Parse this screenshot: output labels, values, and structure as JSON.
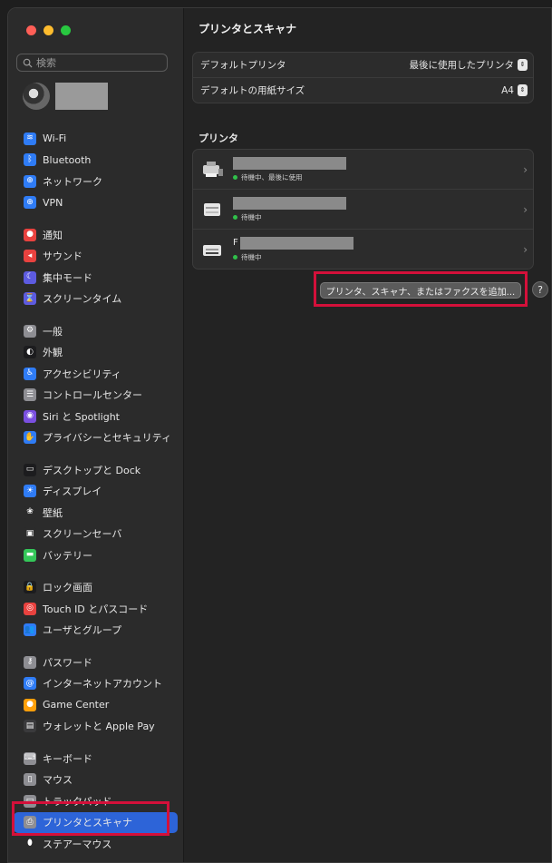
{
  "window": {
    "title": "プリンタとスキャナ"
  },
  "traffic_colors": {
    "close": "#ff5f57",
    "minimize": "#febc2e",
    "zoom": "#28c840"
  },
  "search": {
    "placeholder": "検索"
  },
  "sidebar": {
    "groups": [
      [
        {
          "label": "Wi-Fi",
          "icon": "wifi-icon",
          "color": "#2f7cf6",
          "glyph": "≋"
        },
        {
          "label": "Bluetooth",
          "icon": "bluetooth-icon",
          "color": "#2f7cf6",
          "glyph": "ᛒ"
        },
        {
          "label": "ネットワーク",
          "icon": "globe-icon",
          "color": "#2f7cf6",
          "glyph": "⊕"
        },
        {
          "label": "VPN",
          "icon": "vpn-icon",
          "color": "#2f7cf6",
          "glyph": "⊕"
        }
      ],
      [
        {
          "label": "通知",
          "icon": "bell-icon",
          "color": "#e9423f",
          "glyph": "●"
        },
        {
          "label": "サウンド",
          "icon": "speaker-icon",
          "color": "#e9423f",
          "glyph": "◂"
        },
        {
          "label": "集中モード",
          "icon": "moon-icon",
          "color": "#5d5be0",
          "glyph": "☾"
        },
        {
          "label": "スクリーンタイム",
          "icon": "hourglass-icon",
          "color": "#5d5be0",
          "glyph": "⌛"
        }
      ],
      [
        {
          "label": "一般",
          "icon": "gear-icon",
          "color": "#8e8e93",
          "glyph": "⚙"
        },
        {
          "label": "外観",
          "icon": "appearance-icon",
          "color": "#1c1c1e",
          "glyph": "◐"
        },
        {
          "label": "アクセシビリティ",
          "icon": "accessibility-icon",
          "color": "#2f7cf6",
          "glyph": "♿"
        },
        {
          "label": "コントロールセンター",
          "icon": "control-center-icon",
          "color": "#8e8e93",
          "glyph": "☰"
        },
        {
          "label": "Siri と Spotlight",
          "icon": "siri-icon",
          "color": "#7a4fe0",
          "glyph": "◉"
        },
        {
          "label": "プライバシーとセキュリティ",
          "icon": "hand-icon",
          "color": "#2f7cf6",
          "glyph": "✋"
        }
      ],
      [
        {
          "label": "デスクトップと Dock",
          "icon": "dock-icon",
          "color": "#1c1c1e",
          "glyph": "▭"
        },
        {
          "label": "ディスプレイ",
          "icon": "display-icon",
          "color": "#2f7cf6",
          "glyph": "☀"
        },
        {
          "label": "壁紙",
          "icon": "wallpaper-icon",
          "color": "#2b2b2b",
          "glyph": "❀"
        },
        {
          "label": "スクリーンセーバ",
          "icon": "screensaver-icon",
          "color": "#2b2b2b",
          "glyph": "▣"
        },
        {
          "label": "バッテリー",
          "icon": "battery-icon",
          "color": "#34c759",
          "glyph": "▬"
        }
      ],
      [
        {
          "label": "ロック画面",
          "icon": "lock-icon",
          "color": "#1c1c1e",
          "glyph": "🔒"
        },
        {
          "label": "Touch ID とパスコード",
          "icon": "fingerprint-icon",
          "color": "#e9423f",
          "glyph": "◎"
        },
        {
          "label": "ユーザとグループ",
          "icon": "users-icon",
          "color": "#2f7cf6",
          "glyph": "👥"
        }
      ],
      [
        {
          "label": "パスワード",
          "icon": "key-icon",
          "color": "#8e8e93",
          "glyph": "⚷"
        },
        {
          "label": "インターネットアカウント",
          "icon": "at-icon",
          "color": "#2f7cf6",
          "glyph": "@"
        },
        {
          "label": "Game Center",
          "icon": "game-center-icon",
          "color": "#ff9f0a",
          "glyph": "●"
        },
        {
          "label": "ウォレットと Apple Pay",
          "icon": "wallet-icon",
          "color": "#3a3a3c",
          "glyph": "▤"
        }
      ],
      [
        {
          "label": "キーボード",
          "icon": "keyboard-icon",
          "color": "#8e8e93",
          "glyph": "⌨"
        },
        {
          "label": "マウス",
          "icon": "mouse-icon",
          "color": "#8e8e93",
          "glyph": "▯"
        },
        {
          "label": "トラックパッド",
          "icon": "trackpad-icon",
          "color": "#8e8e93",
          "glyph": "▭"
        },
        {
          "label": "プリンタとスキャナ",
          "icon": "printer-icon",
          "color": "#8e8e93",
          "glyph": "⎙",
          "selected": true
        },
        {
          "label": "ステアーマウス",
          "icon": "steermouse-icon",
          "color": "#2b2b2b",
          "glyph": "⬮"
        }
      ]
    ]
  },
  "defaults": {
    "printer_label": "デフォルトプリンタ",
    "printer_value": "最後に使用したプリンタ",
    "paper_label": "デフォルトの用紙サイズ",
    "paper_value": "A4"
  },
  "printers_section": {
    "title": "プリンタ"
  },
  "printers": [
    {
      "status": "待機中、最後に使用"
    },
    {
      "status": "待機中"
    },
    {
      "status": "待機中",
      "partial_name": "F"
    }
  ],
  "actions": {
    "add_label": "プリンタ、スキャナ、またはファクスを追加...",
    "help_label": "?"
  }
}
